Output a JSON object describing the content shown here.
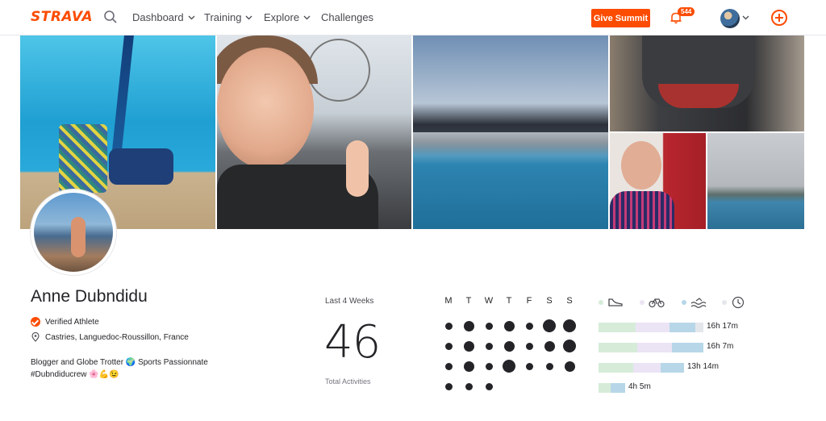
{
  "header": {
    "logo": "STRAVA",
    "nav": [
      {
        "label": "Dashboard",
        "has_menu": true
      },
      {
        "label": "Training",
        "has_menu": true
      },
      {
        "label": "Explore",
        "has_menu": true
      },
      {
        "label": "Challenges",
        "has_menu": false
      }
    ],
    "give_summit": "Give Summit",
    "notification_count": "544",
    "accent": "#fc4c02"
  },
  "profile": {
    "name": "Anne Dubndidu",
    "verified": "Verified Athlete",
    "location": "Castries, Languedoc-Roussillon, France",
    "bio_line1": "Blogger and Globe Trotter 🌍 Sports Passionnate",
    "bio_line2": "#Dubndiducrew 🌸💪😉"
  },
  "stats": {
    "period_label": "Last 4 Weeks",
    "total": "46",
    "total_label": "Total Activities",
    "weekdays": [
      "M",
      "T",
      "W",
      "T",
      "F",
      "S",
      "S"
    ],
    "calendar": [
      [
        1,
        2,
        1,
        2,
        1,
        3,
        3
      ],
      [
        1,
        2,
        1,
        2,
        1,
        2,
        3
      ],
      [
        1,
        2,
        1,
        3,
        1,
        1,
        2
      ],
      [
        1,
        1,
        1,
        0,
        0,
        0,
        0
      ]
    ],
    "sports": [
      {
        "icon": "run-shoe-icon",
        "dot_color": "#d6ecd9"
      },
      {
        "icon": "bike-icon",
        "dot_color": "#ebe4f5"
      },
      {
        "icon": "swim-icon",
        "dot_color": "#b7d7e8"
      },
      {
        "icon": "clock-icon",
        "dot_color": "#e3e6ea"
      }
    ],
    "weeks": [
      {
        "label": "16h 17m",
        "run": 0.35,
        "ride": 0.33,
        "swim": 0.24,
        "other": 0.08
      },
      {
        "label": "16h 7m",
        "run": 0.37,
        "ride": 0.33,
        "swim": 0.3,
        "other": 0.0
      },
      {
        "label": "13h 14m",
        "run": 0.41,
        "ride": 0.32,
        "swim": 0.27,
        "other": 0.0
      },
      {
        "label": "4h 5m",
        "run": 0.46,
        "ride": 0.0,
        "swim": 0.54,
        "other": 0.0
      }
    ]
  }
}
